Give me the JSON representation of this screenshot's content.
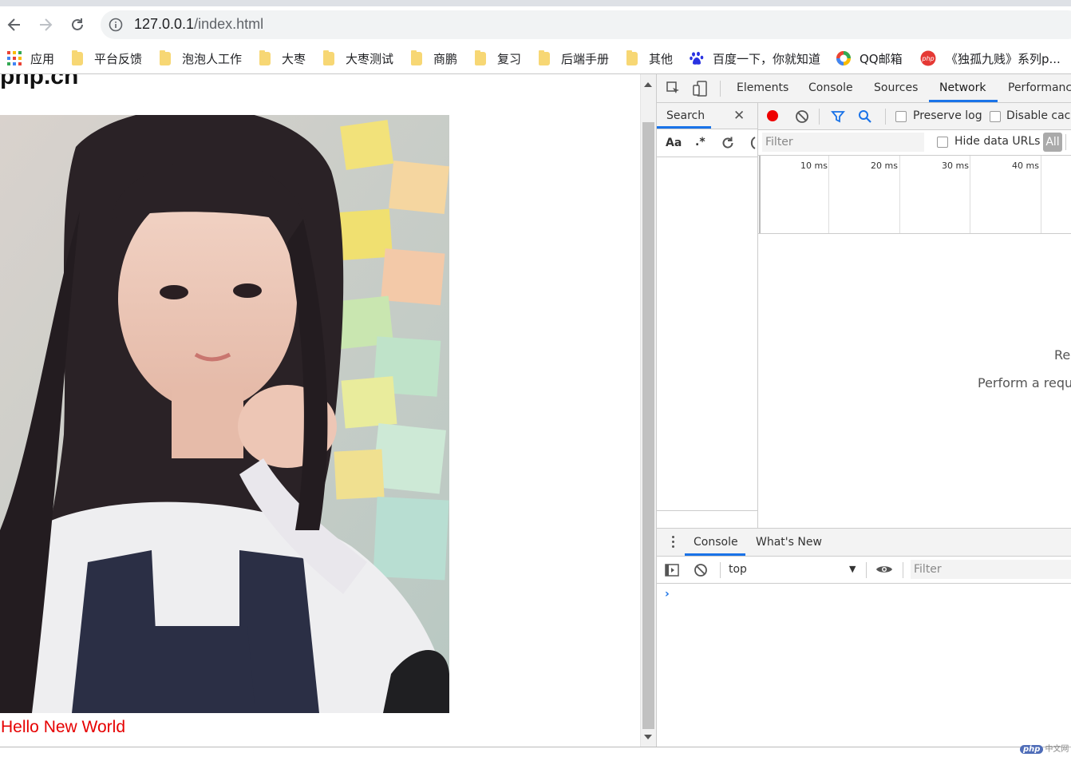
{
  "browser": {
    "url_host": "127.0.0.1",
    "url_path": "/index.html"
  },
  "bookmarks": [
    {
      "label": "应用",
      "icon": "apps-grid-icon"
    },
    {
      "label": "平台反馈",
      "icon": "folder-icon"
    },
    {
      "label": "泡泡人工作",
      "icon": "folder-icon"
    },
    {
      "label": "大枣",
      "icon": "folder-icon"
    },
    {
      "label": "大枣测试",
      "icon": "folder-icon"
    },
    {
      "label": "商鹏",
      "icon": "folder-icon"
    },
    {
      "label": "复习",
      "icon": "folder-icon"
    },
    {
      "label": "后端手册",
      "icon": "folder-icon"
    },
    {
      "label": "其他",
      "icon": "folder-icon"
    },
    {
      "label": "百度一下，你就知道",
      "icon": "baidu-paw-icon"
    },
    {
      "label": "QQ邮箱",
      "icon": "qq-mail-icon"
    },
    {
      "label": "《独孤九贱》系列p...",
      "icon": "php-icon"
    }
  ],
  "page": {
    "title": "pnp.cn",
    "photo_alt": "photo-of-girl",
    "footer_text": "Hello New World",
    "footer_color": "#e60000"
  },
  "devtools": {
    "tabs": [
      "Elements",
      "Console",
      "Sources",
      "Network",
      "Performance"
    ],
    "active_tab": "Network",
    "search_label": "Search",
    "case_label": "Aa",
    "regex_label": ".*",
    "preserve_log": "Preserve log",
    "disable_cache": "Disable cach",
    "filter_placeholder": "Filter",
    "hide_data_urls": "Hide data URLs",
    "all_label": "All",
    "timeline_ticks": [
      "10 ms",
      "20 ms",
      "30 ms",
      "40 ms"
    ],
    "empty_line1": "Re",
    "empty_line2": "Perform a requ",
    "drawer_tabs": [
      "Console",
      "What's New"
    ],
    "console_context": "top",
    "console_filter_placeholder": "Filter",
    "prompt": "›"
  },
  "watermark": {
    "logo": "php",
    "text": "中文网"
  },
  "colors": {
    "accent": "#1a73e8",
    "record": "#e00000"
  }
}
